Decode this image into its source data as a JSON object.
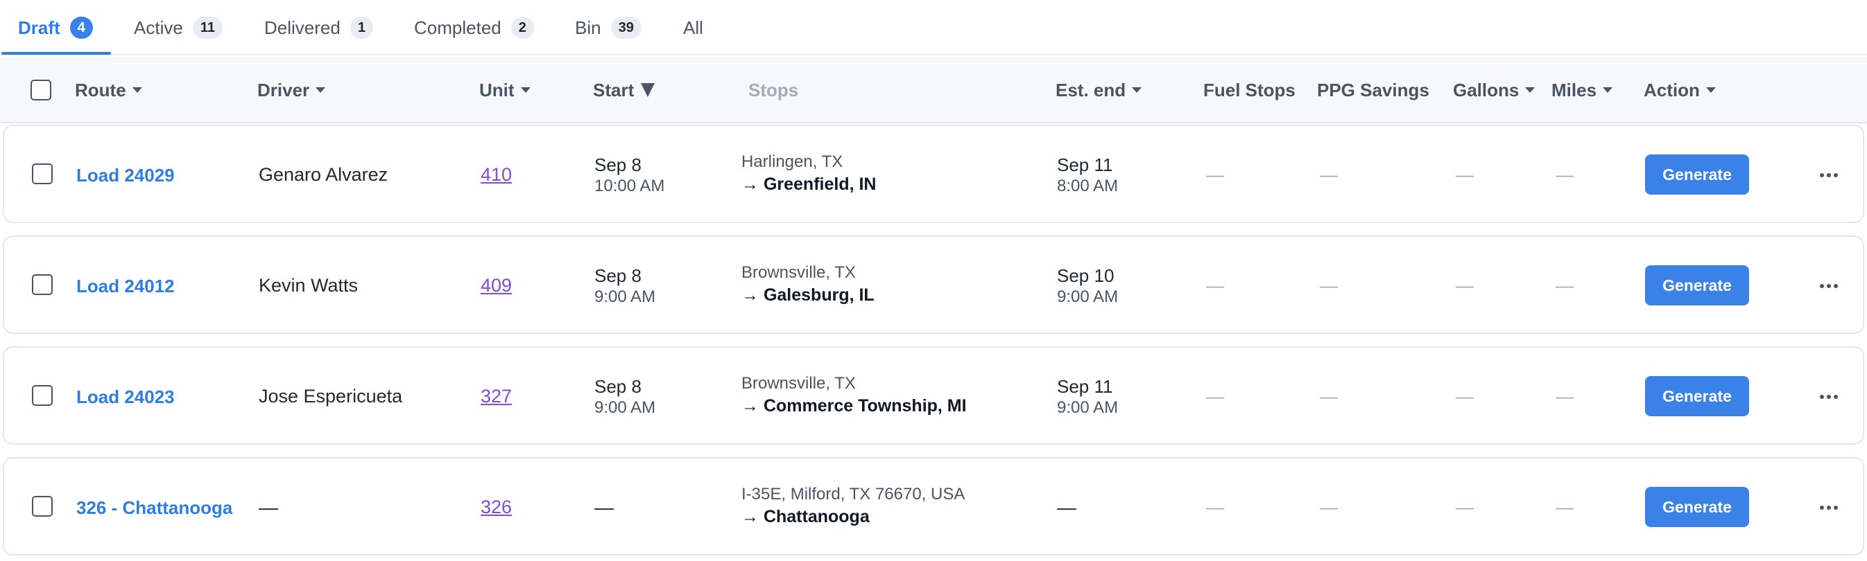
{
  "tabs": [
    {
      "label": "Draft",
      "count": "4"
    },
    {
      "label": "Active",
      "count": "11"
    },
    {
      "label": "Delivered",
      "count": "1"
    },
    {
      "label": "Completed",
      "count": "2"
    },
    {
      "label": "Bin",
      "count": "39"
    },
    {
      "label": "All",
      "count": ""
    }
  ],
  "active_tab": "Draft",
  "columns": {
    "route": "Route",
    "driver": "Driver",
    "unit": "Unit",
    "start": "Start",
    "stops": "Stops",
    "est_end": "Est. end",
    "fuel_stops": "Fuel Stops",
    "ppg_savings": "PPG Savings",
    "gallons": "Gallons",
    "miles": "Miles",
    "action": "Action"
  },
  "rows": [
    {
      "route": "Load 24029",
      "driver": "Genaro Alvarez",
      "unit": "410",
      "start_date": "Sep 8",
      "start_time": "10:00 AM",
      "origin": "Harlingen, TX",
      "destination": "→ Greenfield, IN",
      "end_date": "Sep 11",
      "end_time": "8:00 AM",
      "fuel_stops": "—",
      "ppg_savings": "—",
      "gallons": "—",
      "miles": "—",
      "action": "Generate"
    },
    {
      "route": "Load 24012",
      "driver": "Kevin Watts",
      "unit": "409",
      "start_date": "Sep 8",
      "start_time": "9:00 AM",
      "origin": "Brownsville, TX",
      "destination": "→ Galesburg, IL",
      "end_date": "Sep 10",
      "end_time": "9:00 AM",
      "fuel_stops": "—",
      "ppg_savings": "—",
      "gallons": "—",
      "miles": "—",
      "action": "Generate"
    },
    {
      "route": "Load 24023",
      "driver": "Jose Espericueta",
      "unit": "327",
      "start_date": "Sep 8",
      "start_time": "9:00 AM",
      "origin": "Brownsville, TX",
      "destination": "→ Commerce Township, MI",
      "end_date": "Sep 11",
      "end_time": "9:00 AM",
      "fuel_stops": "—",
      "ppg_savings": "—",
      "gallons": "—",
      "miles": "—",
      "action": "Generate"
    },
    {
      "route": "326 - Chattanooga",
      "driver": "—",
      "unit": "326",
      "start_date": "—",
      "start_time": "",
      "origin": "I-35E, Milford, TX 76670, USA",
      "destination": "→ Chattanooga",
      "end_date": "—",
      "end_time": "",
      "fuel_stops": "—",
      "ppg_savings": "—",
      "gallons": "—",
      "miles": "—",
      "action": "Generate"
    }
  ],
  "colors": {
    "accent": "#3b82e8",
    "link": "#2f7de1",
    "unit_link": "#7c4ddb",
    "header_bg": "#f6f8fb"
  }
}
